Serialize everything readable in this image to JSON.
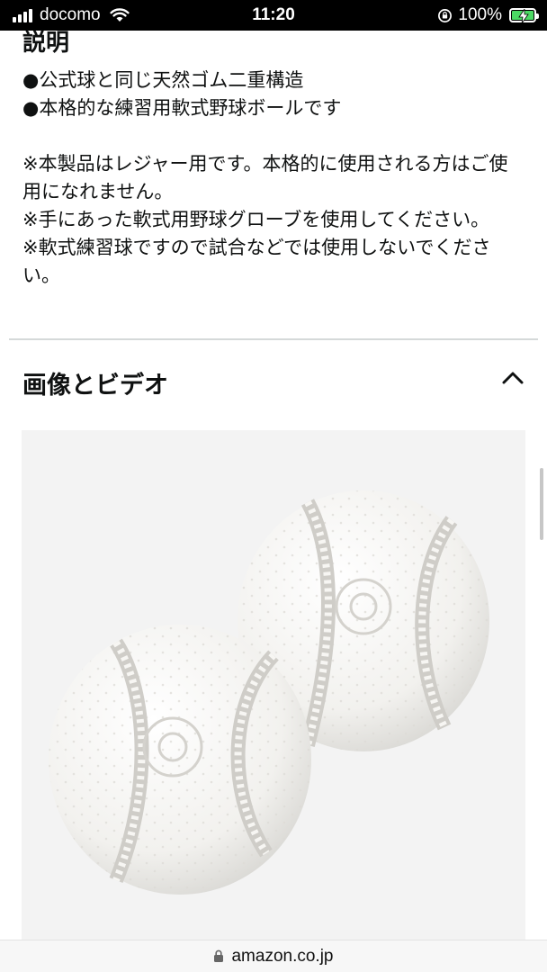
{
  "status_bar": {
    "carrier": "docomo",
    "time": "11:20",
    "battery_percent": "100%",
    "battery_color": "#4cd964"
  },
  "description": {
    "heading": "説明",
    "bullets": [
      "●公式球と同じ天然ゴム二重構造",
      "●本格的な練習用軟式野球ボールです"
    ],
    "notes": [
      "※本製品はレジャー用です。本格的に使用される方はご使用になれません。",
      "※手にあった軟式用野球グローブを使用してください。",
      "※軟式練習球ですので試合などでは使用しないでください。"
    ]
  },
  "media_section": {
    "title": "画像とビデオ",
    "toggle_icon": "chevron-up-icon",
    "image_alt_icon": "baseball-pair-image"
  },
  "url_bar": {
    "domain": "amazon.co.jp",
    "icon": "lock-icon"
  }
}
